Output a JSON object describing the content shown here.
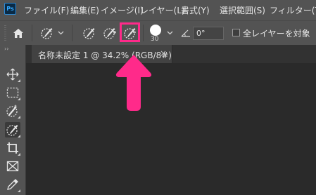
{
  "app": {
    "logo_text": "Ps"
  },
  "menu": {
    "items": [
      "ファイル(F)",
      "編集(E)",
      "イメージ(I)",
      "レイヤー(L)",
      "書式(Y)",
      "選択範囲(S)",
      "フィルター(T)"
    ]
  },
  "options_bar": {
    "brush_size": "30",
    "angle_value": "0°",
    "sample_all_layers_label": "全レイヤーを対象",
    "sample_all_layers_checked": false
  },
  "document_tab": {
    "title": "名称未設定 1 @ 34.2% (RGB/8#)",
    "close_glyph": "×"
  },
  "annotation": {
    "color": "#ff2a8a"
  },
  "toolbar": {
    "expand_glyph": "››"
  }
}
